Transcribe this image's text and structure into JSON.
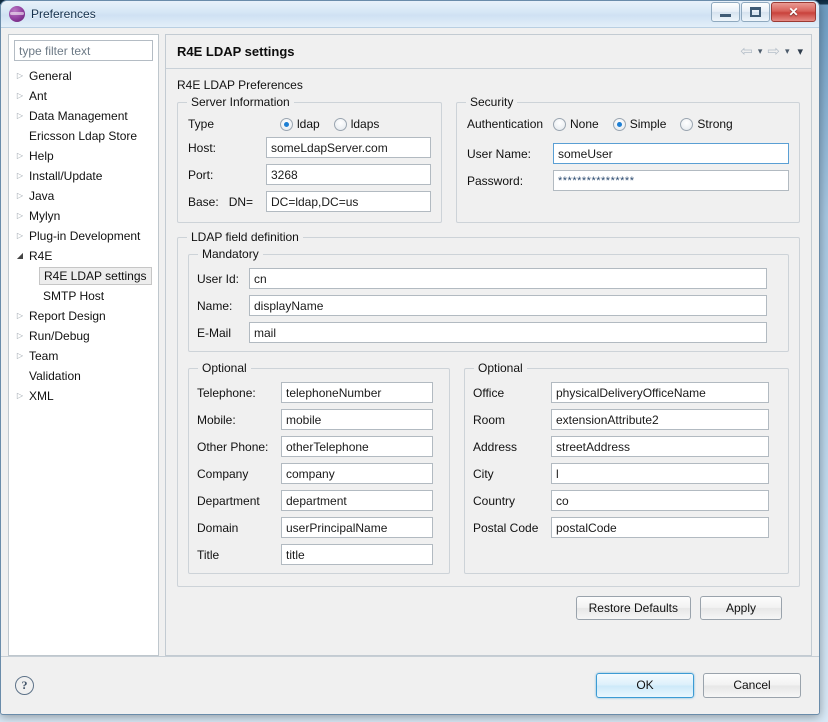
{
  "window": {
    "title": "Preferences",
    "icon": "eclipse-preferences-icon",
    "minimize_label": "Minimize",
    "maximize_label": "Maximize",
    "close_label": "✕"
  },
  "tree": {
    "filter_placeholder": "type filter text",
    "filter_value": "",
    "items": [
      {
        "label": "General",
        "expandable": true,
        "expanded": false,
        "indent": 0,
        "selected": false
      },
      {
        "label": "Ant",
        "expandable": true,
        "expanded": false,
        "indent": 0,
        "selected": false
      },
      {
        "label": "Data Management",
        "expandable": true,
        "expanded": false,
        "indent": 0,
        "selected": false
      },
      {
        "label": "Ericsson Ldap Store",
        "expandable": false,
        "expanded": false,
        "indent": 0,
        "selected": false
      },
      {
        "label": "Help",
        "expandable": true,
        "expanded": false,
        "indent": 0,
        "selected": false
      },
      {
        "label": "Install/Update",
        "expandable": true,
        "expanded": false,
        "indent": 0,
        "selected": false
      },
      {
        "label": "Java",
        "expandable": true,
        "expanded": false,
        "indent": 0,
        "selected": false
      },
      {
        "label": "Mylyn",
        "expandable": true,
        "expanded": false,
        "indent": 0,
        "selected": false
      },
      {
        "label": "Plug-in Development",
        "expandable": true,
        "expanded": false,
        "indent": 0,
        "selected": false
      },
      {
        "label": "R4E",
        "expandable": true,
        "expanded": true,
        "indent": 0,
        "selected": false
      },
      {
        "label": "R4E LDAP settings",
        "expandable": false,
        "expanded": false,
        "indent": 1,
        "selected": true
      },
      {
        "label": "SMTP Host",
        "expandable": false,
        "expanded": false,
        "indent": 1,
        "selected": false
      },
      {
        "label": "Report Design",
        "expandable": true,
        "expanded": false,
        "indent": 0,
        "selected": false
      },
      {
        "label": "Run/Debug",
        "expandable": true,
        "expanded": false,
        "indent": 0,
        "selected": false
      },
      {
        "label": "Team",
        "expandable": true,
        "expanded": false,
        "indent": 0,
        "selected": false
      },
      {
        "label": "Validation",
        "expandable": false,
        "expanded": false,
        "indent": 0,
        "selected": false
      },
      {
        "label": "XML",
        "expandable": true,
        "expanded": false,
        "indent": 0,
        "selected": false
      }
    ]
  },
  "page": {
    "title": "R4E LDAP settings",
    "subtitle": "R4E LDAP Preferences",
    "nav": {
      "back_icon": "⇦",
      "back_caret": "▾",
      "forward_icon": "⇨",
      "forward_caret": "▾",
      "menu_caret": "▾"
    }
  },
  "server_information": {
    "group_label": "Server Information",
    "type_label": "Type",
    "type_options": [
      {
        "label": "ldap",
        "selected": true
      },
      {
        "label": "ldaps",
        "selected": false
      }
    ],
    "host_label": "Host:",
    "host_value": "someLdapServer.com",
    "port_label": "Port:",
    "port_value": "3268",
    "base_label": "Base:",
    "dn_label": "DN=",
    "base_value": "DC=ldap,DC=us"
  },
  "security": {
    "group_label": "Security",
    "auth_label": "Authentication",
    "auth_options": [
      {
        "label": "None",
        "selected": false
      },
      {
        "label": "Simple",
        "selected": true
      },
      {
        "label": "Strong",
        "selected": false
      }
    ],
    "username_label": "User Name:",
    "username_value": "someUser",
    "password_label": "Password:",
    "password_value": "****************"
  },
  "ldap_field_definition": {
    "group_label": "LDAP field definition",
    "mandatory": {
      "group_label": "Mandatory",
      "fields": [
        {
          "label": "User Id:",
          "value": "cn"
        },
        {
          "label": "Name:",
          "value": "displayName"
        },
        {
          "label": "E-Mail",
          "value": "mail"
        }
      ]
    },
    "optional_left": {
      "group_label": "Optional",
      "fields": [
        {
          "label": "Telephone:",
          "value": "telephoneNumber"
        },
        {
          "label": "Mobile:",
          "value": "mobile"
        },
        {
          "label": "Other Phone:",
          "value": "otherTelephone"
        },
        {
          "label": "Company",
          "value": "company"
        },
        {
          "label": "Department",
          "value": "department"
        },
        {
          "label": "Domain",
          "value": "userPrincipalName"
        },
        {
          "label": "Title",
          "value": "title"
        }
      ]
    },
    "optional_right": {
      "group_label": "Optional",
      "fields": [
        {
          "label": "Office",
          "value": "physicalDeliveryOfficeName"
        },
        {
          "label": "Room",
          "value": "extensionAttribute2"
        },
        {
          "label": "Address",
          "value": "streetAddress"
        },
        {
          "label": "City",
          "value": "l"
        },
        {
          "label": "Country",
          "value": "co"
        },
        {
          "label": "Postal Code",
          "value": "postalCode"
        }
      ]
    }
  },
  "buttons": {
    "restore_defaults": "Restore Defaults",
    "restore_defaults_mnemonic": "D",
    "apply": "Apply",
    "apply_mnemonic": "A",
    "ok": "OK",
    "cancel": "Cancel",
    "help": "?"
  },
  "colors": {
    "accent": "#1d7fd4",
    "dialog_bg": "#f0f0f0",
    "field_border": "#b2bac1",
    "focus_border": "#5a9fd4"
  }
}
